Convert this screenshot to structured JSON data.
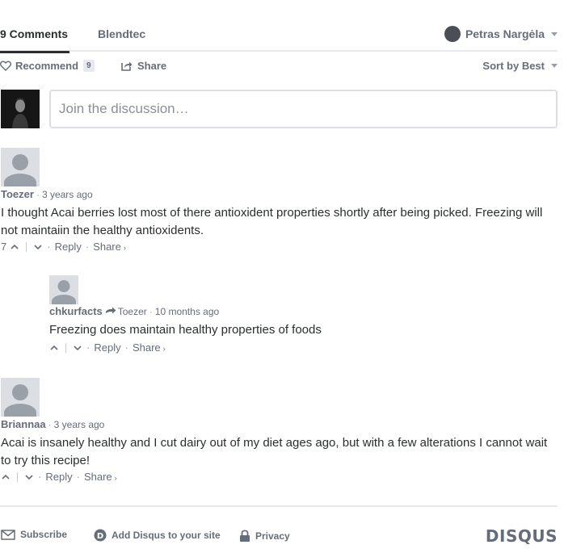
{
  "nav": {
    "comments_tab": "9 Comments",
    "forum_tab": "Blendtec",
    "user_name": "Petras Nargėla"
  },
  "actions": {
    "recommend_label": "Recommend",
    "recommend_count": "9",
    "share_label": "Share",
    "sort_label": "Sort by Best"
  },
  "composer": {
    "placeholder": "Join the discussion…"
  },
  "comments": [
    {
      "author": "Toezer",
      "time": "3 years ago",
      "text": "I thought Acai berries lost most of there antioxident properties shortly after being picked. Freezing will not maintaiin the healthy antioxidents.",
      "votes": "7",
      "reply_label": "Reply",
      "share_label": "Share"
    },
    {
      "author": "chkurfacts",
      "in_reply_to": "Toezer",
      "time": "10 months ago",
      "text": "Freezing does maintain healthy properties of foods",
      "votes": "",
      "reply_label": "Reply",
      "share_label": "Share"
    },
    {
      "author": "Briannaa",
      "time": "3 years ago",
      "text": "Acai is insanely healthy and I cut dairy out of my diet ages ago, but with a few alterations I cannot wait to try this recipe!",
      "votes": "",
      "reply_label": "Reply",
      "share_label": "Share"
    }
  ],
  "footer": {
    "subscribe_label": "Subscribe",
    "add_disqus_label": "Add Disqus to your site",
    "privacy_label": "Privacy",
    "brand": "DISQUS"
  },
  "icons": {
    "heart": "heart-icon",
    "share": "share-icon",
    "envelope": "envelope-icon",
    "disqus": "disqus-d-icon",
    "lock": "lock-icon"
  }
}
